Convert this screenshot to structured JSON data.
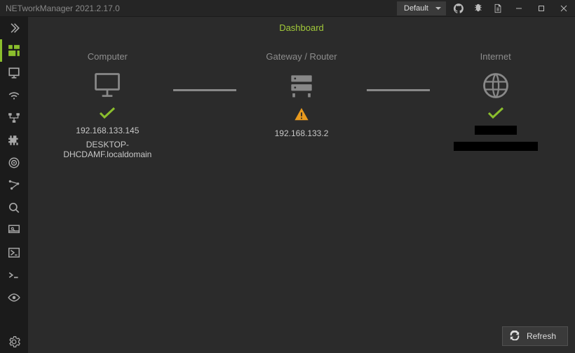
{
  "app": {
    "title": "NETworkManager 2021.2.17.0",
    "profile_selected": "Default"
  },
  "page": {
    "title": "Dashboard"
  },
  "dashboard": {
    "computer": {
      "label": "Computer",
      "status": "ok",
      "ip": "192.168.133.145",
      "hostname": "DESKTOP-DHCDAMF.localdomain"
    },
    "gateway": {
      "label": "Gateway / Router",
      "status": "warn",
      "ip": "192.168.133.2"
    },
    "internet": {
      "label": "Internet",
      "status": "ok"
    }
  },
  "actions": {
    "refresh": "Refresh"
  }
}
